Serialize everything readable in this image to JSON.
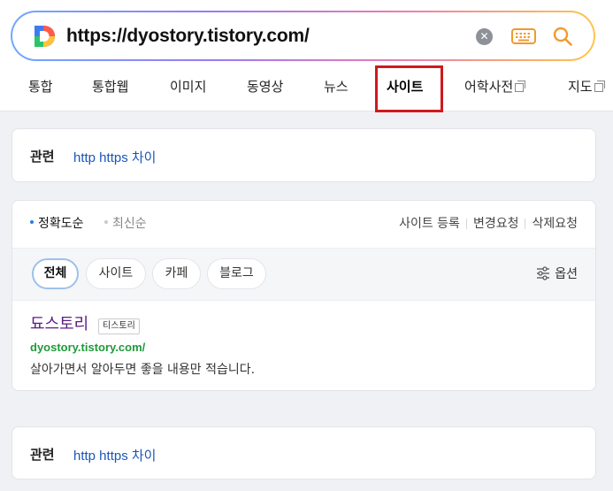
{
  "search": {
    "query": "https://dyostory.tistory.com/",
    "logo_letter": "D"
  },
  "tabs": [
    {
      "label": "통합",
      "external": false
    },
    {
      "label": "통합웹",
      "external": false
    },
    {
      "label": "이미지",
      "external": false
    },
    {
      "label": "동영상",
      "external": false
    },
    {
      "label": "뉴스",
      "external": false
    },
    {
      "label": "사이트",
      "external": false,
      "active": true
    },
    {
      "label": "어학사전",
      "external": true
    },
    {
      "label": "지도",
      "external": true
    }
  ],
  "related_top": {
    "label": "관련",
    "link": "http https 차이"
  },
  "sort": {
    "accuracy": "정확도순",
    "latest": "최신순"
  },
  "actions": {
    "register": "사이트 등록",
    "change": "변경요청",
    "delete": "삭제요청"
  },
  "filters": {
    "all": "전체",
    "site": "사이트",
    "cafe": "카페",
    "blog": "블로그",
    "options": "옵션"
  },
  "result": {
    "title": "됴스토리",
    "badge": "티스토리",
    "url": "dyostory.tistory.com/",
    "description": "살아가면서 알아두면 좋을 내용만 적습니다."
  },
  "related_bottom": {
    "label": "관련",
    "link": "http https 차이"
  },
  "colors": {
    "link": "#1a56b8",
    "visited_title": "#5b1d84",
    "url_green": "#1f9a3a",
    "highlight_red": "#d0191d",
    "accent_blue": "#2c7be5"
  }
}
